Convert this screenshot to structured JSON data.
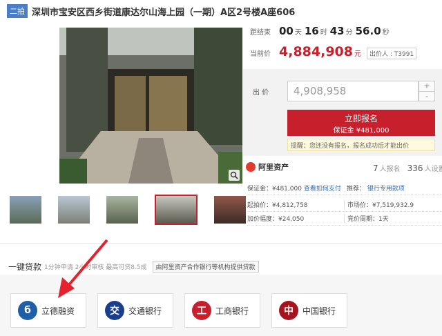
{
  "header": {
    "tag": "二拍",
    "title": "深圳市宝安区西乡街道康达尔山海上园（一期）A区2号楼A座606"
  },
  "auction": {
    "countdown_label": "距结束",
    "days": "00",
    "days_unit": "天",
    "hours": "16",
    "hours_unit": "时",
    "minutes": "43",
    "minutes_unit": "分",
    "seconds": "56.0",
    "seconds_unit": "秒",
    "current_price_label": "当前价",
    "current_price": "4,884,908",
    "price_unit": "元",
    "bidder_label": "出价人 : T3991"
  },
  "bid": {
    "label": "出  价",
    "input_value": "4,908,958",
    "plus": "+",
    "minus": "-",
    "apply_label": "立即报名",
    "deposit_label": "保证金 ¥481,000",
    "notice": "提醒：您还没有报名，报名成功后才能出价"
  },
  "platform": {
    "name": "阿里资产",
    "applicants_count": "7",
    "applicants_label": "人报名",
    "watchers_count": "336",
    "watchers_label": "人设置"
  },
  "details": {
    "deposit": "保证金：¥481,000",
    "deposit_link": "查看如何支付",
    "recommend": "推荐：",
    "recommend_link": "银行专用款项",
    "start_price": "起拍价：¥4,812,758",
    "market_price": "市场价：¥7,519,932.9",
    "increment": "加价幅度：¥24,050",
    "period": "竞价周期：1天"
  },
  "loan": {
    "title": "一键贷款",
    "subtitle": "1分钟申请 2小时审核 最高可贷8.5成",
    "note": "由阿里资产合作银行等机构提供贷款",
    "banks": [
      {
        "name": "立德融资",
        "color": "#1f5fa8",
        "glyph": "б"
      },
      {
        "name": "交通银行",
        "color": "#1a3e8c",
        "glyph": "交"
      },
      {
        "name": "工商银行",
        "color": "#c7202c",
        "glyph": "工"
      },
      {
        "name": "中国银行",
        "color": "#a4151d",
        "glyph": "中"
      }
    ]
  },
  "colors": {
    "accent": "#c7202c",
    "link": "#3a6db5",
    "tag": "#4a7fc7"
  },
  "icons": {
    "zoom": "magnifier-icon",
    "alibaba": "ali-asset-logo-icon"
  }
}
